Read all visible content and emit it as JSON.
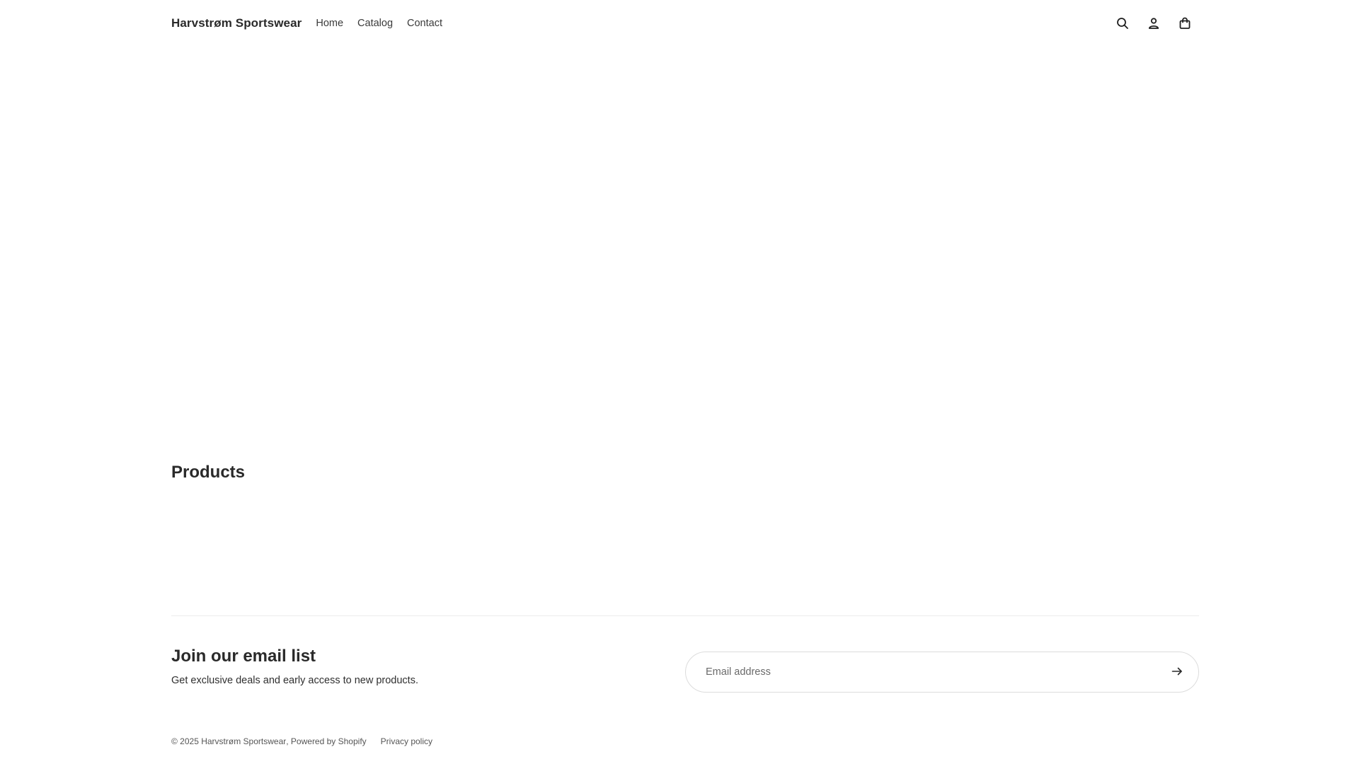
{
  "header": {
    "brand": "Harvstrøm Sportswear",
    "nav": [
      "Home",
      "Catalog",
      "Contact"
    ],
    "icons": [
      "search-icon",
      "account-icon",
      "cart-icon"
    ]
  },
  "products": {
    "title": "Products"
  },
  "newsletter": {
    "title": "Join our email list",
    "subtitle": "Get exclusive deals and early access to new products.",
    "placeholder": "Email address"
  },
  "footer": {
    "copyright_prefix": "© 2025",
    "copyright_brand": "Harvstrøm Sportswear",
    "powered_by": "Powered by Shopify",
    "privacy": "Privacy policy"
  },
  "colors": {
    "text": "#1f1f1f",
    "muted": "#555555",
    "border": "#dcdcdc",
    "divider": "#ececec",
    "background": "#ffffff"
  }
}
